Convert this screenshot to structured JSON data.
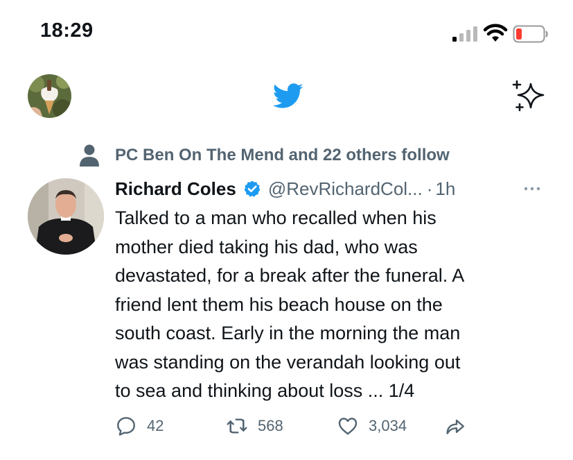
{
  "status_bar": {
    "time": "18:29",
    "signal_icon": "cellular-signal-icon",
    "wifi_icon": "wifi-icon",
    "battery_icon": "battery-low-icon",
    "battery_level_color": "#ff3b30"
  },
  "top_bar": {
    "profile_avatar_icon": "profile-avatar-icon",
    "logo_icon": "twitter-bird-icon",
    "logo_color": "#1d9bf0",
    "timeline_icon": "sparkle-icon"
  },
  "tweet": {
    "social_context": "PC Ben On The Mend and 22 others follow",
    "author": "Richard Coles",
    "verified": true,
    "verified_color": "#1d9bf0",
    "handle": "@RevRichardCol...",
    "separator": "·",
    "age": "1h",
    "text_lines": [
      "Talked to a man who recalled when his",
      "mother died taking his dad, who was",
      "devastated, for a break after the funeral. A",
      "friend lent them his beach house on the",
      "south coast. Early in the morning the man",
      "was standing on the verandah looking out",
      "to sea and thinking about loss ... 1/4"
    ],
    "actions": {
      "replies": "42",
      "retweets": "568",
      "likes": "3,034"
    }
  }
}
